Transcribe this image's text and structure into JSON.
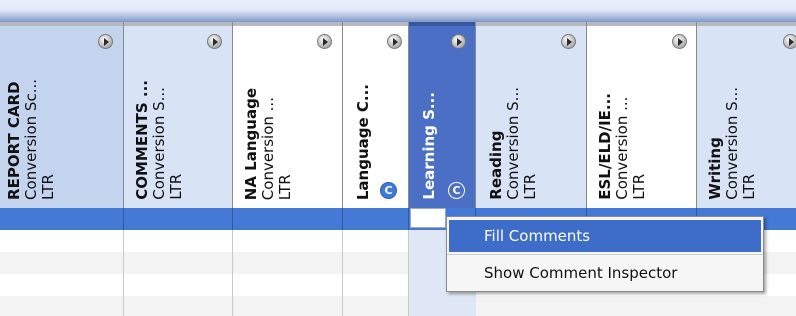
{
  "header": {
    "columns": [
      {
        "title": "REPORT CARD",
        "subtitle": "Conversion Sc...",
        "direction": "LTR",
        "style": "firstcol"
      },
      {
        "title": "COMMENTS ...",
        "subtitle": "Conversion S...",
        "direction": "LTR",
        "style": "blue"
      },
      {
        "title": "NA Language",
        "subtitle": "Conversion ...",
        "direction": "LTR",
        "style": "white"
      },
      {
        "title": "Language C...",
        "subtitle": "",
        "direction": "",
        "style": "white",
        "badge": "C"
      },
      {
        "title": "Learning S...",
        "subtitle": "",
        "direction": "",
        "style": "selected",
        "badge": "C"
      },
      {
        "title": "Reading",
        "subtitle": "Conversion S...",
        "direction": "LTR",
        "style": "blue"
      },
      {
        "title": "ESL/ELD/IE...",
        "subtitle": "Conversion ...",
        "direction": "LTR",
        "style": "white"
      },
      {
        "title": "Writing",
        "subtitle": "Conversion S...",
        "direction": "LTR",
        "style": "blue"
      }
    ]
  },
  "context_menu": {
    "items": [
      {
        "label": "Fill Comments",
        "hover": true
      },
      {
        "label": "Show Comment Inspector",
        "hover": false
      }
    ]
  },
  "icons": {
    "arrow": "arrow-right-circle-icon",
    "badge": "comment-c-icon"
  },
  "colors": {
    "selected_column": "#4a6fc4",
    "selected_row": "#4479d6",
    "menu_hover": "#3d6dc8"
  }
}
